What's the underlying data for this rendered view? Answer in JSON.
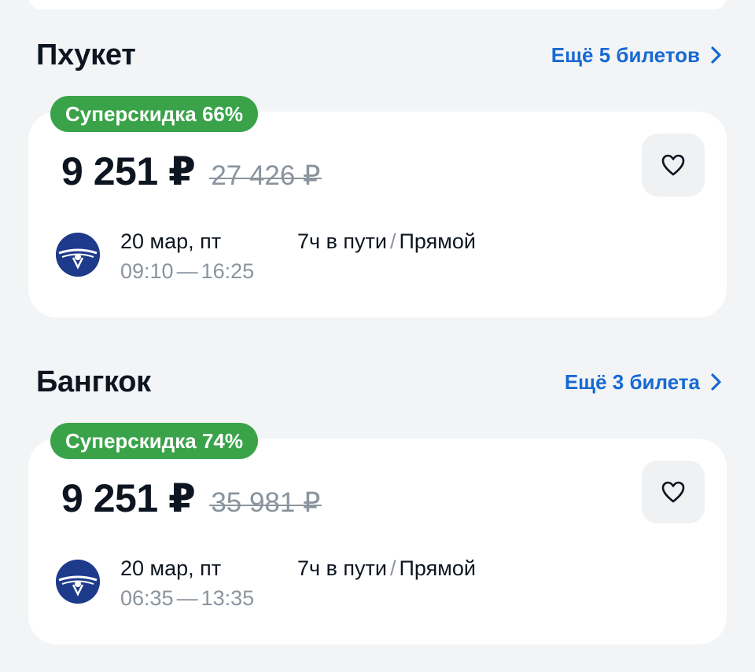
{
  "offers": [
    {
      "city": "Пхукет",
      "more_label": "Ещё 5 билетов",
      "badge": "Суперскидка 66%",
      "price": "9 251 ₽",
      "old_price": "27 426 ₽",
      "date": "20 мар, пт",
      "depart": "09:10",
      "arrive": "16:25",
      "separator": "—",
      "duration": "7ч в пути",
      "slash": "/",
      "stops": "Прямой"
    },
    {
      "city": "Бангкок",
      "more_label": "Ещё 3 билета",
      "badge": "Суперскидка 74%",
      "price": "9 251 ₽",
      "old_price": "35 981 ₽",
      "date": "20 мар, пт",
      "depart": "06:35",
      "arrive": "13:35",
      "separator": "—",
      "duration": "7ч в пути",
      "slash": "/",
      "stops": "Прямой"
    }
  ],
  "icons": {
    "more": "chevron-right-icon",
    "favorite": "heart-icon",
    "airline": "airline-logo"
  },
  "colors": {
    "accent_link": "#1769d1",
    "badge_green": "#3aa34a",
    "muted_text": "#8a949e",
    "airline_blue": "#1e3a8a"
  }
}
